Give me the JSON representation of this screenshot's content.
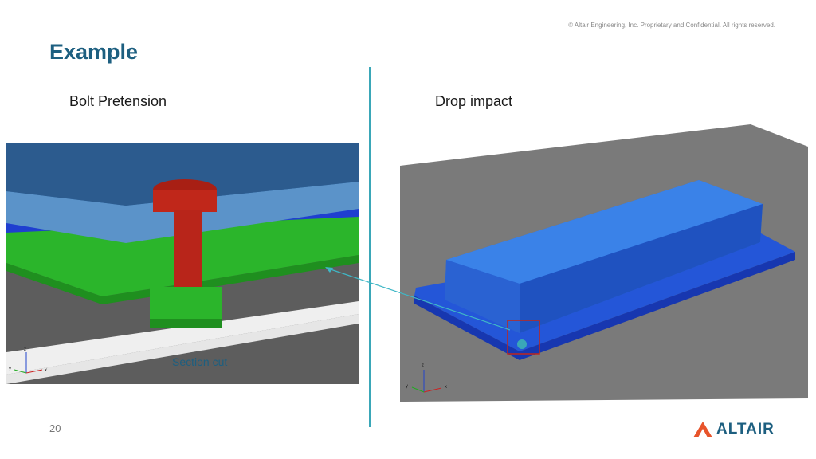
{
  "header": {
    "copyright": "© Altair Engineering, Inc. Proprietary and Confidential. All rights reserved.",
    "title": "Example"
  },
  "panels": {
    "left": {
      "heading": "Bolt Pretension",
      "caption": "Section cut",
      "axis_labels": {
        "z": "z",
        "y": "y",
        "x": "x"
      }
    },
    "right": {
      "heading": "Drop impact",
      "axis_labels": {
        "z": "z",
        "y": "y",
        "x": "x"
      }
    }
  },
  "footer": {
    "page_number": "20",
    "logo_text": "ALTAIR"
  },
  "colors": {
    "title": "#1d5f80",
    "divider": "#3aa7b8",
    "bolt": "#c0271a",
    "plate_blue": "#3f7fc0",
    "plate_green": "#2bb52b",
    "logo_accent": "#e8542b",
    "highlight_box": "#c0271a"
  },
  "icons": [
    "altair-logo-icon",
    "axis-triad-icon",
    "callout-arrow-icon"
  ]
}
